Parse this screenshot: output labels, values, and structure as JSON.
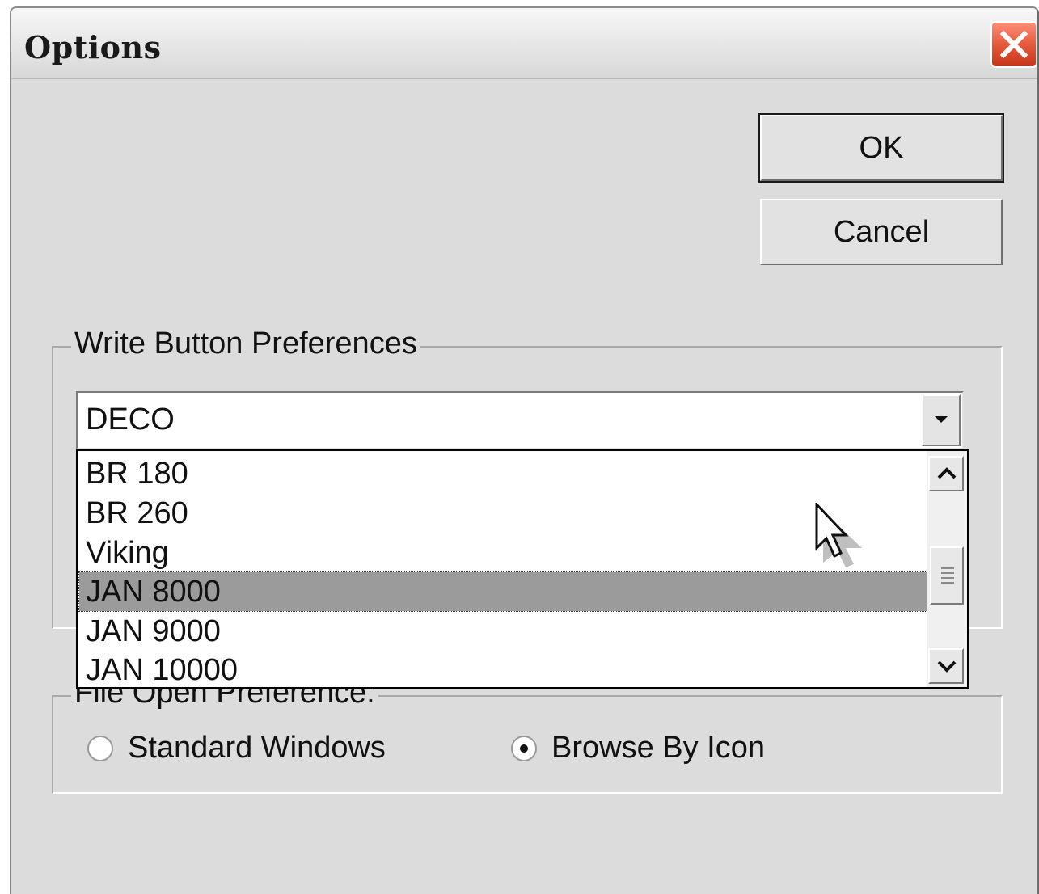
{
  "window": {
    "title": "Options"
  },
  "buttons": {
    "ok_label": "OK",
    "cancel_label": "Cancel"
  },
  "write_button_preferences": {
    "legend": "Write Button Preferences",
    "selected_value": "DECO",
    "options": [
      {
        "label": "BR 180",
        "highlighted": false
      },
      {
        "label": "BR 260",
        "highlighted": false
      },
      {
        "label": "Viking",
        "highlighted": false
      },
      {
        "label": "JAN 8000",
        "highlighted": true
      },
      {
        "label": "JAN 9000",
        "highlighted": false
      },
      {
        "label": "JAN 10000",
        "highlighted": false
      }
    ]
  },
  "file_open_preference": {
    "legend": "File Open Preference:",
    "options": [
      {
        "label": "Standard Windows",
        "selected": false
      },
      {
        "label": "Browse By Icon",
        "selected": true
      }
    ]
  },
  "icons": {
    "close": "close-icon",
    "dropdown_arrow": "chevron-down-icon",
    "scroll_up": "chevron-up-icon",
    "scroll_down": "chevron-down-icon",
    "scroll_thumb_grip": "grip-icon",
    "cursor": "mouse-pointer-icon"
  },
  "colors": {
    "dialog_background": "#dcdcdc",
    "highlight": "#9b9b9b",
    "close_button": "#e55a3c"
  }
}
